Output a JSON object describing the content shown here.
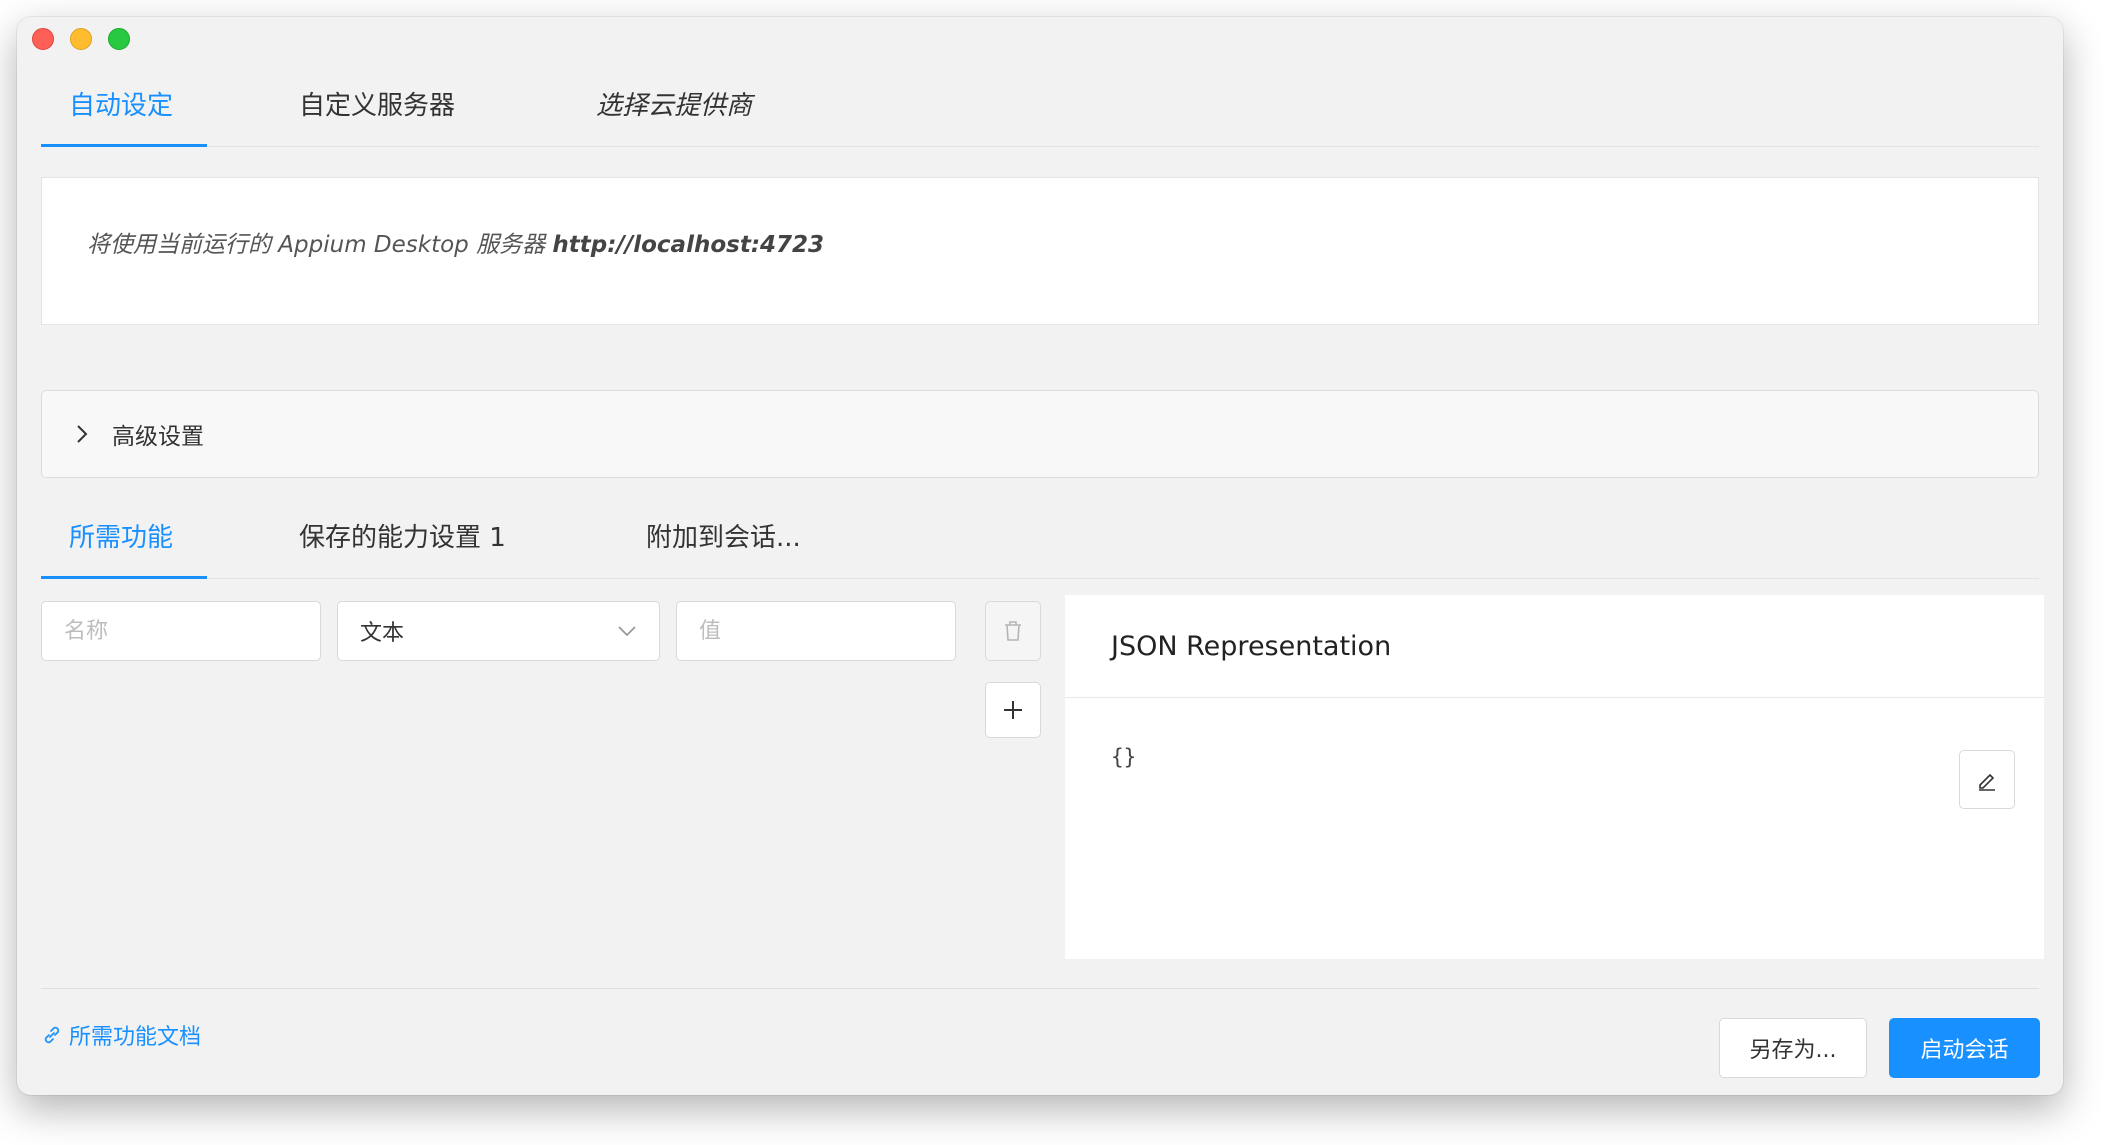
{
  "top_tabs": [
    {
      "label": "自动设定",
      "active": true
    },
    {
      "label": "自定义服务器",
      "active": false
    },
    {
      "label": "选择云提供商",
      "active": false
    }
  ],
  "info": {
    "prefix": "将使用当前运行的 Appium Desktop 服务器 ",
    "url": "http://localhost:4723"
  },
  "advanced": {
    "label": "高级设置"
  },
  "cap_tabs": [
    {
      "label": "所需功能",
      "active": true
    },
    {
      "label": "保存的能力设置 1",
      "active": false
    },
    {
      "label": "附加到会话...",
      "active": false
    }
  ],
  "capability": {
    "name_placeholder": "名称",
    "type_value": "文本",
    "value_placeholder": "值"
  },
  "json_panel": {
    "title": "JSON Representation",
    "content": "{}"
  },
  "footer": {
    "doc_link": "所需功能文档",
    "save_as": "另存为...",
    "start_session": "启动会话"
  },
  "colors": {
    "accent": "#1890ff",
    "close": "#fe5f57",
    "minimize": "#febc2e",
    "maximize": "#28c840"
  },
  "icons": [
    "chevron-right-icon",
    "chevron-down-icon",
    "trash-icon",
    "plus-icon",
    "edit-icon",
    "link-icon"
  ]
}
